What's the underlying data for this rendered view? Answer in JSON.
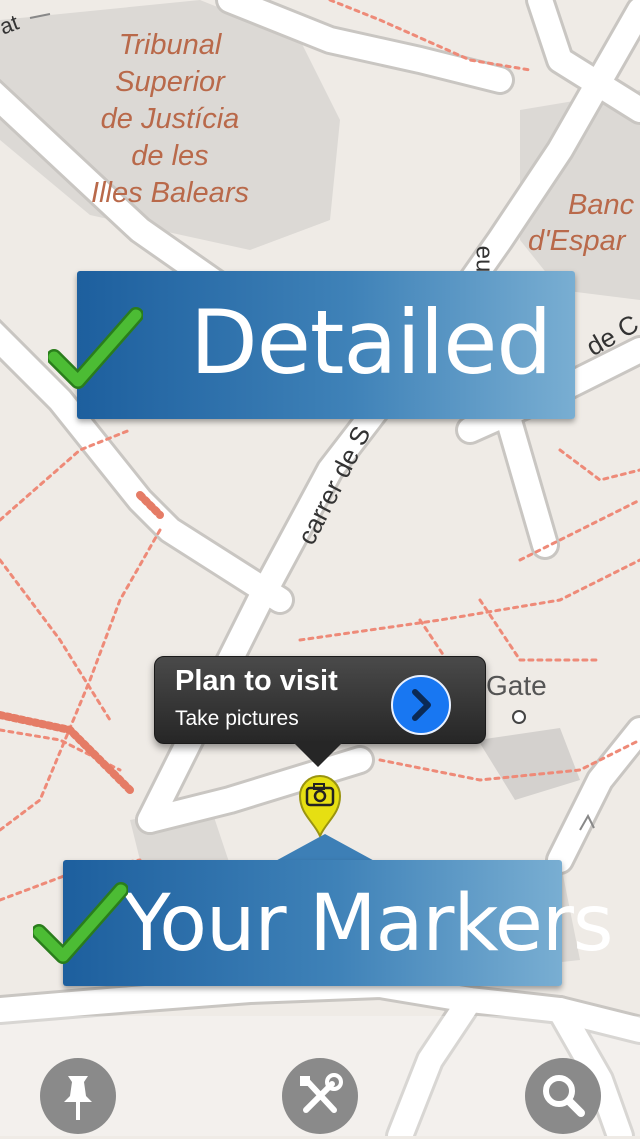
{
  "map": {
    "places": {
      "court": [
        "Tribunal",
        "Superior",
        "de Justícia",
        "de les",
        "Illes Balears"
      ],
      "bank": [
        "Banc",
        "d'Espar"
      ]
    },
    "streets": {
      "carrer_s": "carrer de S",
      "de_c": "de C",
      "top_left": "at",
      "vertical_fragment": "eu"
    },
    "poi": {
      "gate_label": "Gate"
    }
  },
  "banners": {
    "detailed": "Detailed",
    "markers": "Your Markers"
  },
  "callout": {
    "title": "Plan to visit",
    "subtitle": "Take pictures"
  },
  "marker": {
    "icon": "camera-icon",
    "color": "#e6df12"
  },
  "toolbar": {
    "buttons": [
      {
        "icon": "pin-icon"
      },
      {
        "icon": "tools-icon"
      },
      {
        "icon": "search-icon"
      }
    ]
  },
  "colors": {
    "banner_start": "#1d5f9e",
    "banner_end": "#79aed2",
    "check": "#3fae2a",
    "disclosure": "#1877f2",
    "map_label": "#b9694a"
  }
}
